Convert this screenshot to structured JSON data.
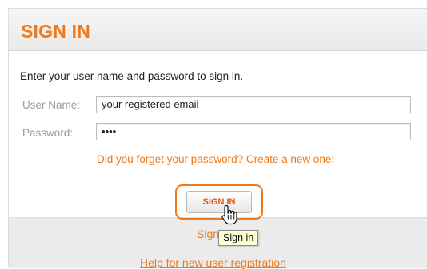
{
  "header": {
    "title": "SIGN IN"
  },
  "form": {
    "intro": "Enter your user name and password to sign in.",
    "username_label": "User Name:",
    "username_value": "your registered email",
    "password_label": "Password:",
    "password_value": "••••",
    "forgot_link": "Did you forget your password? Create a new one!",
    "submit_label": "SIGN IN"
  },
  "footer": {
    "signin_link": "Sign in",
    "help_link": "Help for new user registration"
  },
  "tooltip": {
    "text": "Sign in"
  },
  "colors": {
    "accent": "#ee7a1c",
    "button_text": "#e2561b",
    "footer_bg": "#ebebeb",
    "tooltip_bg": "#ffffd6"
  },
  "icons": {
    "pointer": "hand-pointer-icon"
  }
}
